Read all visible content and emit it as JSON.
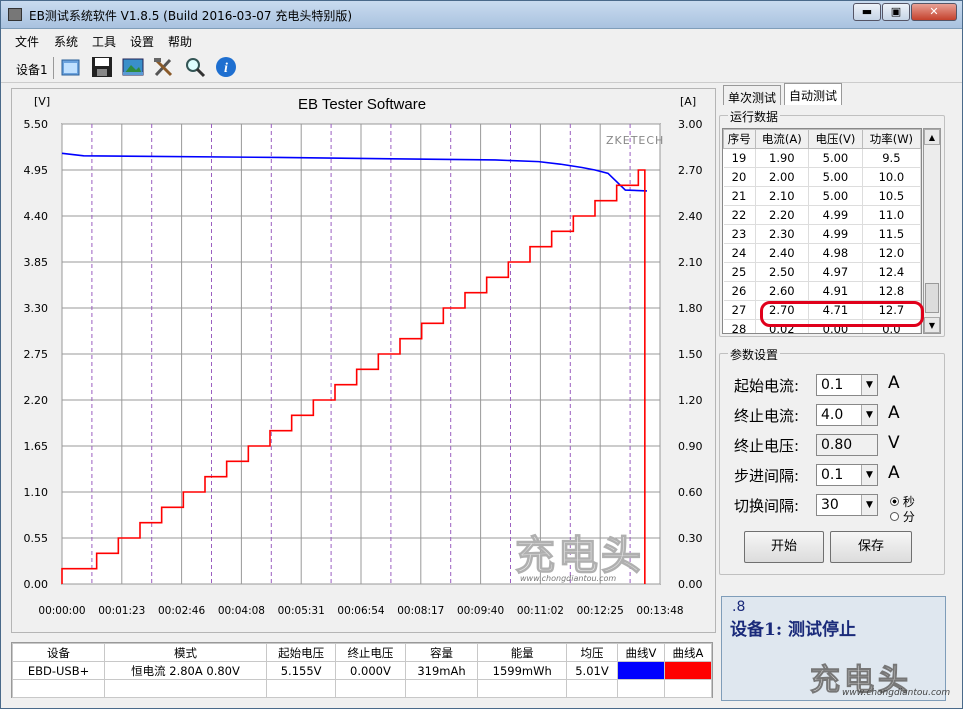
{
  "window": {
    "title": "EB测试系统软件 V1.8.5 (Build 2016-03-07 充电头特别版)",
    "min": "▬",
    "max": "▣",
    "close": "✕"
  },
  "menu": [
    "文件",
    "系统",
    "工具",
    "设置",
    "帮助"
  ],
  "toolbar": {
    "device": "设备1",
    "icons": [
      "open-folder-icon",
      "save-disk-icon",
      "image-icon",
      "tools-icon",
      "magnifier-icon",
      "info-icon"
    ]
  },
  "chart": {
    "title": "EB Tester Software",
    "left_unit": "[V]",
    "right_unit": "[A]",
    "watermark": "ZKETECH",
    "logo_text": "充电头",
    "logo_url": "www.chongdiantou.com",
    "left_ticks": [
      "5.50",
      "4.95",
      "4.40",
      "3.85",
      "3.30",
      "2.75",
      "2.20",
      "1.65",
      "1.10",
      "0.55",
      "0.00"
    ],
    "right_ticks": [
      "3.00",
      "2.70",
      "2.40",
      "2.10",
      "1.80",
      "1.50",
      "1.20",
      "0.90",
      "0.60",
      "0.30",
      "0.00"
    ],
    "x_ticks": [
      "00:00:00",
      "00:01:23",
      "00:02:46",
      "00:04:08",
      "00:05:31",
      "00:06:54",
      "00:08:17",
      "00:09:40",
      "00:11:02",
      "00:12:25",
      "00:13:48"
    ],
    "colors": {
      "voltage": "#0000ff",
      "current": "#ff0000",
      "grid_v": "#9b5fc0"
    }
  },
  "chart_data": {
    "type": "line",
    "title": "EB Tester Software",
    "xlabel": "",
    "ylabel": "[V]",
    "y2label": "[A]",
    "x_range": [
      "00:00:00",
      "00:13:48"
    ],
    "ylim": [
      0,
      5.5
    ],
    "y2lim": [
      0,
      3.0
    ],
    "series": [
      {
        "axis": "left",
        "points": [
          [
            0,
            5.15
          ],
          [
            0.5,
            5.12
          ],
          [
            5,
            5.1
          ],
          [
            10,
            5.07
          ],
          [
            11,
            5.05
          ],
          [
            11.5,
            5.02
          ],
          [
            12,
            4.98
          ],
          [
            12.3,
            4.95
          ],
          [
            12.6,
            4.91
          ],
          [
            13,
            4.71
          ],
          [
            13.5,
            4.7
          ]
        ]
      },
      {
        "axis": "right",
        "steps": [
          0.1,
          0.2,
          0.3,
          0.4,
          0.5,
          0.6,
          0.7,
          0.8,
          0.9,
          1.0,
          1.1,
          1.2,
          1.3,
          1.4,
          1.5,
          1.6,
          1.7,
          1.8,
          1.9,
          2.0,
          2.1,
          2.2,
          2.3,
          2.4,
          2.5,
          2.6,
          2.7,
          0.02
        ]
      }
    ]
  },
  "right": {
    "tab1": "单次测试",
    "tab2": "自动测试",
    "run_label": "运行数据",
    "table_headers": [
      "序号",
      "电流(A)",
      "电压(V)",
      "功率(W)"
    ],
    "rows": [
      [
        "19",
        "1.90",
        "5.00",
        "9.5"
      ],
      [
        "20",
        "2.00",
        "5.00",
        "10.0"
      ],
      [
        "21",
        "2.10",
        "5.00",
        "10.5"
      ],
      [
        "22",
        "2.20",
        "4.99",
        "11.0"
      ],
      [
        "23",
        "2.30",
        "4.99",
        "11.5"
      ],
      [
        "24",
        "2.40",
        "4.98",
        "12.0"
      ],
      [
        "25",
        "2.50",
        "4.97",
        "12.4"
      ],
      [
        "26",
        "2.60",
        "4.91",
        "12.8"
      ],
      [
        "27",
        "2.70",
        "4.71",
        "12.7"
      ],
      [
        "28",
        "0.02",
        "0.00",
        "0.0"
      ]
    ],
    "param_label": "参数设置",
    "params": [
      {
        "label": "起始电流:",
        "value": "0.1",
        "unit": "A",
        "dropdown": true
      },
      {
        "label": "终止电流:",
        "value": "4.0",
        "unit": "A",
        "dropdown": true
      },
      {
        "label": "终止电压:",
        "value": "0.80",
        "unit": "V",
        "dropdown": false
      },
      {
        "label": "步进间隔:",
        "value": "0.1",
        "unit": "A",
        "dropdown": true
      },
      {
        "label": "切换间隔:",
        "value": "30",
        "unit": "",
        "dropdown": true
      }
    ],
    "radio_sec": "秒",
    "radio_min": "分",
    "start": "开始",
    "save": "保存"
  },
  "status": {
    "code": ".8",
    "message": "设备1: 测试停止"
  },
  "bottom": {
    "headers": [
      "设备",
      "模式",
      "起始电压",
      "终止电压",
      "容量",
      "能量",
      "均压",
      "曲线V",
      "曲线A"
    ],
    "row": [
      "EBD-USB+",
      "恒电流 2.80A 0.80V",
      "5.155V",
      "0.000V",
      "319mAh",
      "1599mWh",
      "5.01V",
      "",
      ""
    ],
    "curve_v_color": "#0000ff",
    "curve_a_color": "#ff0000"
  }
}
